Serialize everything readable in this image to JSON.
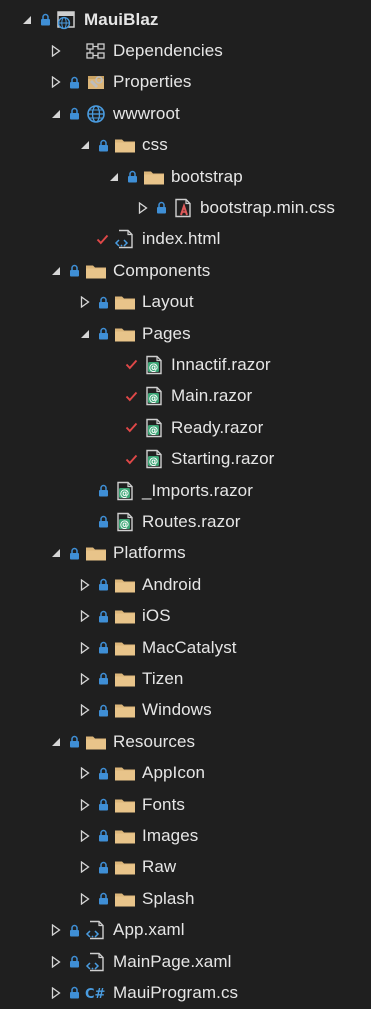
{
  "colors": {
    "background": "#1f1f1f",
    "text": "#e6e6e6",
    "lock": "#3f8fd6",
    "folder": "#dcb67a",
    "check": "#e04848",
    "razor": "#3ba575",
    "globe": "#4a9ce0",
    "csharp": "#4a9ce0"
  },
  "tree": [
    {
      "label": "MauiBlaz",
      "depth": 0,
      "expander": "expanded",
      "lock": true,
      "icon": "project-icon",
      "bold": true
    },
    {
      "label": "Dependencies",
      "depth": 1,
      "expander": "collapsed",
      "lock": false,
      "icon": "dependencies-icon"
    },
    {
      "label": "Properties",
      "depth": 1,
      "expander": "collapsed",
      "lock": true,
      "icon": "properties-icon"
    },
    {
      "label": "wwwroot",
      "depth": 1,
      "expander": "expanded",
      "lock": true,
      "icon": "globe-icon"
    },
    {
      "label": "css",
      "depth": 2,
      "expander": "expanded",
      "lock": true,
      "icon": "folder-icon"
    },
    {
      "label": "bootstrap",
      "depth": 3,
      "expander": "expanded",
      "lock": true,
      "icon": "folder-icon"
    },
    {
      "label": "bootstrap.min.css",
      "depth": 4,
      "expander": "collapsed",
      "lock": true,
      "icon": "css-file-icon"
    },
    {
      "label": "index.html",
      "depth": 2,
      "expander": "none",
      "lock": false,
      "check": true,
      "icon": "code-file-icon"
    },
    {
      "label": "Components",
      "depth": 1,
      "expander": "expanded",
      "lock": true,
      "icon": "folder-icon"
    },
    {
      "label": "Layout",
      "depth": 2,
      "expander": "collapsed",
      "lock": true,
      "icon": "folder-icon"
    },
    {
      "label": "Pages",
      "depth": 2,
      "expander": "expanded",
      "lock": true,
      "icon": "folder-icon"
    },
    {
      "label": "Innactif.razor",
      "depth": 3,
      "expander": "none",
      "lock": false,
      "check": true,
      "icon": "razor-file-icon"
    },
    {
      "label": "Main.razor",
      "depth": 3,
      "expander": "none",
      "lock": false,
      "check": true,
      "icon": "razor-file-icon"
    },
    {
      "label": "Ready.razor",
      "depth": 3,
      "expander": "none",
      "lock": false,
      "check": true,
      "icon": "razor-file-icon"
    },
    {
      "label": "Starting.razor",
      "depth": 3,
      "expander": "none",
      "lock": false,
      "check": true,
      "icon": "razor-file-icon"
    },
    {
      "label": "_Imports.razor",
      "depth": 2,
      "expander": "none",
      "lock": true,
      "icon": "razor-file-icon"
    },
    {
      "label": "Routes.razor",
      "depth": 2,
      "expander": "none",
      "lock": true,
      "icon": "razor-file-icon"
    },
    {
      "label": "Platforms",
      "depth": 1,
      "expander": "expanded",
      "lock": true,
      "icon": "folder-icon"
    },
    {
      "label": "Android",
      "depth": 2,
      "expander": "collapsed",
      "lock": true,
      "icon": "folder-icon"
    },
    {
      "label": "iOS",
      "depth": 2,
      "expander": "collapsed",
      "lock": true,
      "icon": "folder-icon"
    },
    {
      "label": "MacCatalyst",
      "depth": 2,
      "expander": "collapsed",
      "lock": true,
      "icon": "folder-icon"
    },
    {
      "label": "Tizen",
      "depth": 2,
      "expander": "collapsed",
      "lock": true,
      "icon": "folder-icon"
    },
    {
      "label": "Windows",
      "depth": 2,
      "expander": "collapsed",
      "lock": true,
      "icon": "folder-icon"
    },
    {
      "label": "Resources",
      "depth": 1,
      "expander": "expanded",
      "lock": true,
      "icon": "folder-icon"
    },
    {
      "label": "AppIcon",
      "depth": 2,
      "expander": "collapsed",
      "lock": true,
      "icon": "folder-icon"
    },
    {
      "label": "Fonts",
      "depth": 2,
      "expander": "collapsed",
      "lock": true,
      "icon": "folder-icon"
    },
    {
      "label": "Images",
      "depth": 2,
      "expander": "collapsed",
      "lock": true,
      "icon": "folder-icon"
    },
    {
      "label": "Raw",
      "depth": 2,
      "expander": "collapsed",
      "lock": true,
      "icon": "folder-icon"
    },
    {
      "label": "Splash",
      "depth": 2,
      "expander": "collapsed",
      "lock": true,
      "icon": "folder-icon"
    },
    {
      "label": "App.xaml",
      "depth": 1,
      "expander": "collapsed",
      "lock": true,
      "icon": "xaml-file-icon"
    },
    {
      "label": "MainPage.xaml",
      "depth": 1,
      "expander": "collapsed",
      "lock": true,
      "icon": "xaml-file-icon"
    },
    {
      "label": "MauiProgram.cs",
      "depth": 1,
      "expander": "collapsed",
      "lock": true,
      "icon": "csharp-file-icon"
    }
  ]
}
